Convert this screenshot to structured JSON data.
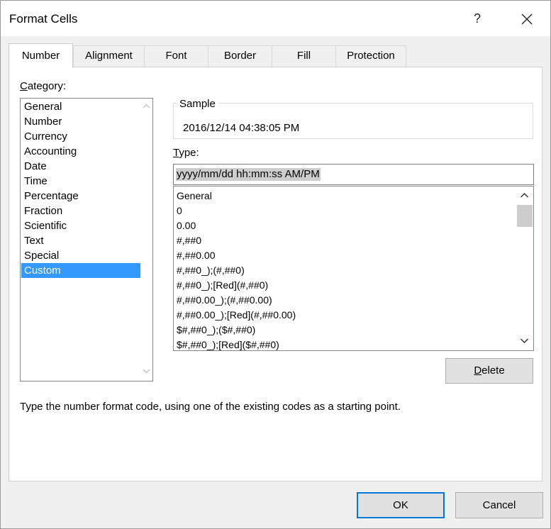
{
  "window": {
    "title": "Format Cells",
    "help_label": "?",
    "close_label": "✕"
  },
  "tabs": [
    {
      "label": "Number",
      "active": true
    },
    {
      "label": "Alignment",
      "active": false
    },
    {
      "label": "Font",
      "active": false
    },
    {
      "label": "Border",
      "active": false
    },
    {
      "label": "Fill",
      "active": false
    },
    {
      "label": "Protection",
      "active": false
    }
  ],
  "category": {
    "label_accel": "C",
    "label_rest": "ategory:",
    "items": [
      "General",
      "Number",
      "Currency",
      "Accounting",
      "Date",
      "Time",
      "Percentage",
      "Fraction",
      "Scientific",
      "Text",
      "Special",
      "Custom"
    ],
    "selected": "Custom"
  },
  "sample": {
    "legend": "Sample",
    "value": "2016/12/14 04:38:05 PM"
  },
  "type": {
    "label_accel": "T",
    "label_rest": "ype:",
    "value": "yyyy/mm/dd hh:mm:ss AM/PM"
  },
  "format_codes": [
    "General",
    "0",
    "0.00",
    "#,##0",
    "#,##0.00",
    "#,##0_);(#,##0)",
    "#,##0_);[Red](#,##0)",
    "#,##0.00_);(#,##0.00)",
    "#,##0.00_);[Red](#,##0.00)",
    "$#,##0_);($#,##0)",
    "$#,##0_);[Red]($#,##0)"
  ],
  "buttons": {
    "delete_accel": "D",
    "delete_rest": "elete",
    "ok": "OK",
    "cancel": "Cancel"
  },
  "hint": "Type the number format code, using one of the existing codes as a starting point.",
  "icons": {
    "scroll_up": "chevron-up-icon",
    "scroll_down": "chevron-down-icon"
  },
  "colors": {
    "selection": "#3399ff",
    "focus_border": "#0078d7"
  }
}
